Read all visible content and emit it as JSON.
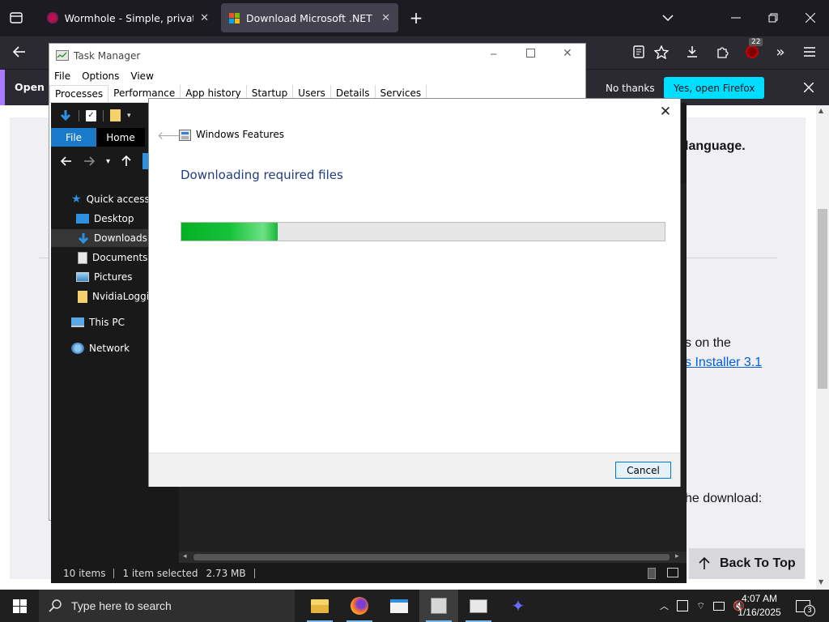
{
  "firefox": {
    "tabs": [
      {
        "title": "Wormhole - Simple, private file",
        "active": false
      },
      {
        "title": "Download Microsoft .NET Fram",
        "active": true
      }
    ],
    "extension_badge": "22",
    "notification": {
      "text": "Open Fi",
      "no_thanks": "No thanks",
      "yes_open": "Yes, open Firefox"
    }
  },
  "webpage": {
    "text_language": "language.",
    "text_on_the": "s on the",
    "link_installer": "s Installer 3.1",
    "text_download": "he download:",
    "back_to_top": "Back To Top"
  },
  "task_manager": {
    "title": "Task Manager",
    "menu": [
      "File",
      "Options",
      "View"
    ],
    "tabs": [
      "Processes",
      "Performance",
      "App history",
      "Startup",
      "Users",
      "Details",
      "Services"
    ]
  },
  "file_explorer": {
    "ribbon": {
      "file": "File",
      "home": "Home"
    },
    "sidebar": {
      "quick_access": "Quick access",
      "desktop": "Desktop",
      "downloads": "Downloads",
      "documents": "Documents",
      "pictures": "Pictures",
      "nvidia": "NvidiaLoggi",
      "this_pc": "This PC",
      "network": "Network"
    },
    "status": {
      "items": "10 items",
      "selected": "1 item selected",
      "size": "2.73 MB"
    }
  },
  "windows_features": {
    "title": "Windows Features",
    "heading": "Downloading required files",
    "progress_fraction": 0.2,
    "cancel": "Cancel"
  },
  "taskbar": {
    "search_placeholder": "Type here to search",
    "time": "4:07 AM",
    "date": "1/16/2025",
    "notifications_count": "3"
  }
}
